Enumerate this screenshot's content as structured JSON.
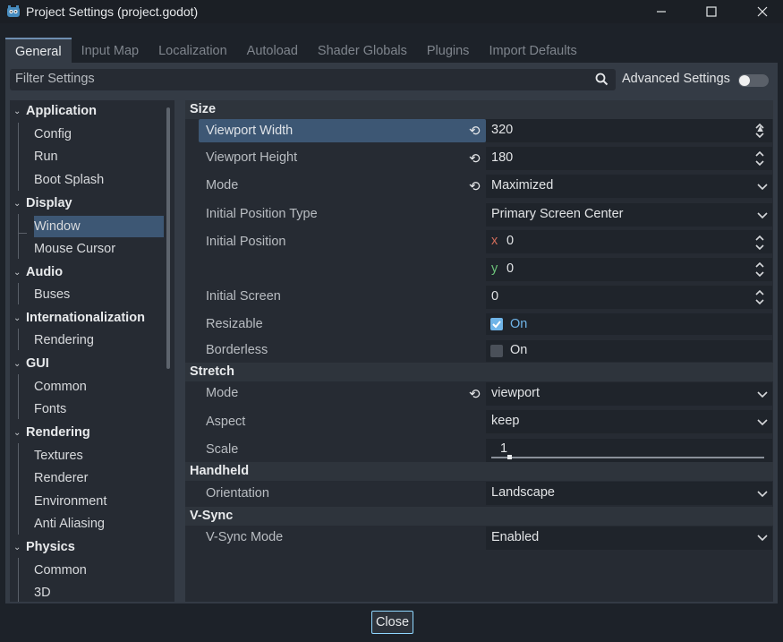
{
  "window": {
    "title": "Project Settings (project.godot)"
  },
  "tabs": [
    "General",
    "Input Map",
    "Localization",
    "Autoload",
    "Shader Globals",
    "Plugins",
    "Import Defaults"
  ],
  "filter": {
    "placeholder": "Filter Settings"
  },
  "advanced_settings": {
    "label": "Advanced Settings",
    "enabled": false
  },
  "sidebar": {
    "sections": [
      {
        "label": "Application",
        "items": [
          "Config",
          "Run",
          "Boot Splash"
        ]
      },
      {
        "label": "Display",
        "items": [
          "Window",
          "Mouse Cursor"
        ],
        "selected": "Window"
      },
      {
        "label": "Audio",
        "items": [
          "Buses"
        ]
      },
      {
        "label": "Internationalization",
        "items": [
          "Rendering"
        ]
      },
      {
        "label": "GUI",
        "items": [
          "Common",
          "Fonts"
        ]
      },
      {
        "label": "Rendering",
        "items": [
          "Textures",
          "Renderer",
          "Environment",
          "Anti Aliasing"
        ]
      },
      {
        "label": "Physics",
        "items": [
          "Common",
          "3D"
        ]
      }
    ]
  },
  "content": {
    "size": {
      "header": "Size",
      "viewport_width": {
        "label": "Viewport Width",
        "value": "320"
      },
      "viewport_height": {
        "label": "Viewport Height",
        "value": "180"
      },
      "mode": {
        "label": "Mode",
        "value": "Maximized"
      },
      "initial_position_type": {
        "label": "Initial Position Type",
        "value": "Primary Screen Center"
      },
      "initial_position": {
        "label": "Initial Position",
        "x_axis": "x",
        "x": "0",
        "y_axis": "y",
        "y": "0"
      },
      "initial_screen": {
        "label": "Initial Screen",
        "value": "0"
      },
      "resizable": {
        "label": "Resizable",
        "value": "On",
        "checked": true
      },
      "borderless": {
        "label": "Borderless",
        "value": "On",
        "checked": false
      }
    },
    "stretch": {
      "header": "Stretch",
      "mode": {
        "label": "Mode",
        "value": "viewport"
      },
      "aspect": {
        "label": "Aspect",
        "value": "keep"
      },
      "scale": {
        "label": "Scale",
        "value": "1"
      }
    },
    "handheld": {
      "header": "Handheld",
      "orientation": {
        "label": "Orientation",
        "value": "Landscape"
      }
    },
    "vsync": {
      "header": "V-Sync",
      "mode": {
        "label": "V-Sync Mode",
        "value": "Enabled"
      }
    }
  },
  "footer": {
    "close_label": "Close"
  },
  "colors": {
    "accent": "#3d5774",
    "highlight_blue": "#6fb4e8",
    "x_axis": "#d06c5a",
    "y_axis": "#6cc27a"
  }
}
